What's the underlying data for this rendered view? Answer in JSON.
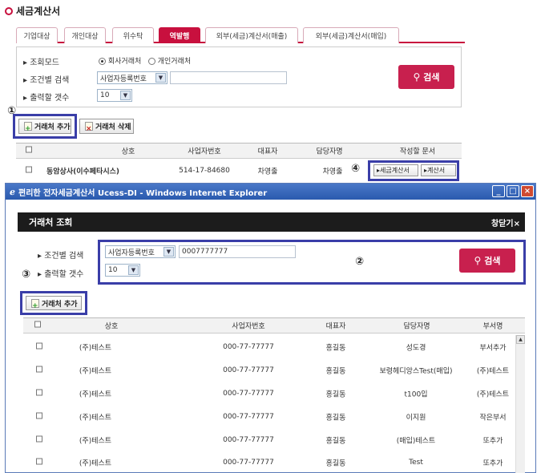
{
  "page_title": "세금계산서",
  "tabs": [
    "기업대상",
    "개인대상",
    "위수탁",
    "역발행",
    "외부(세금)계산서(매출)",
    "외부(세금)계산서(매입)"
  ],
  "search": {
    "mode_label": "▸ 조회모드",
    "mode_company": "회사거래처",
    "mode_personal": "개인거래처",
    "cond_label": "▸ 조건별 검색",
    "cond_value": "사업자등록번호",
    "count_label": "▸ 출력할 갯수",
    "count_value": "10",
    "search_btn": "검색"
  },
  "actions": {
    "add_partner": "거래처 추가",
    "delete_partner": "거래처 삭제"
  },
  "callouts": [
    "①",
    "②",
    "③",
    "④"
  ],
  "main_table": {
    "headers": [
      "상호",
      "사업자번호",
      "대표자",
      "담당자명",
      "작성할 문서"
    ],
    "row": {
      "name": "동암상사(이수페타시스)",
      "bizno": "514-17-84680",
      "rep": "차영출",
      "manager": "차영출",
      "doc1": "▸세금계산서",
      "doc2": "▸계산서"
    }
  },
  "popup": {
    "window_title": "편리한 전자세금계산서 Ucess-DI - Windows Internet Explorer",
    "header": "거래처 조회",
    "close": "창닫기×",
    "cond_label": "▸ 조건별 검색",
    "cond_value": "사업자등록번호",
    "cond_input": "0007777777",
    "count_label": "▸ 출력할 갯수",
    "count_value": "10",
    "search_btn": "검색",
    "add_btn": "거래처 추가",
    "headers": [
      "상호",
      "사업자번호",
      "대표자",
      "담당자명",
      "부서명"
    ],
    "rows": [
      {
        "name": "(주)테스트",
        "bizno": "000-77-77777",
        "rep": "홍길동",
        "manager": "성도경",
        "dept": "부서추가"
      },
      {
        "name": "(주)테스트",
        "bizno": "000-77-77777",
        "rep": "홍길동",
        "manager": "보령헤디앙스Test(매입)",
        "dept": "(주)테스트"
      },
      {
        "name": "(주)테스트",
        "bizno": "000-77-77777",
        "rep": "홍길동",
        "manager": "t100입",
        "dept": "(주)테스트"
      },
      {
        "name": "(주)테스트",
        "bizno": "000-77-77777",
        "rep": "홍길동",
        "manager": "이지원",
        "dept": "작은부서"
      },
      {
        "name": "(주)테스트",
        "bizno": "000-77-77777",
        "rep": "홍길동",
        "manager": "(매입)테스트",
        "dept": "또추가"
      },
      {
        "name": "(주)테스트",
        "bizno": "000-77-77777",
        "rep": "홍길동",
        "manager": "Test",
        "dept": "또추가"
      }
    ]
  },
  "colors": {
    "accent": "#c8103e",
    "highlight": "#3a3ea8",
    "ie_bar": "#2a5aae"
  }
}
